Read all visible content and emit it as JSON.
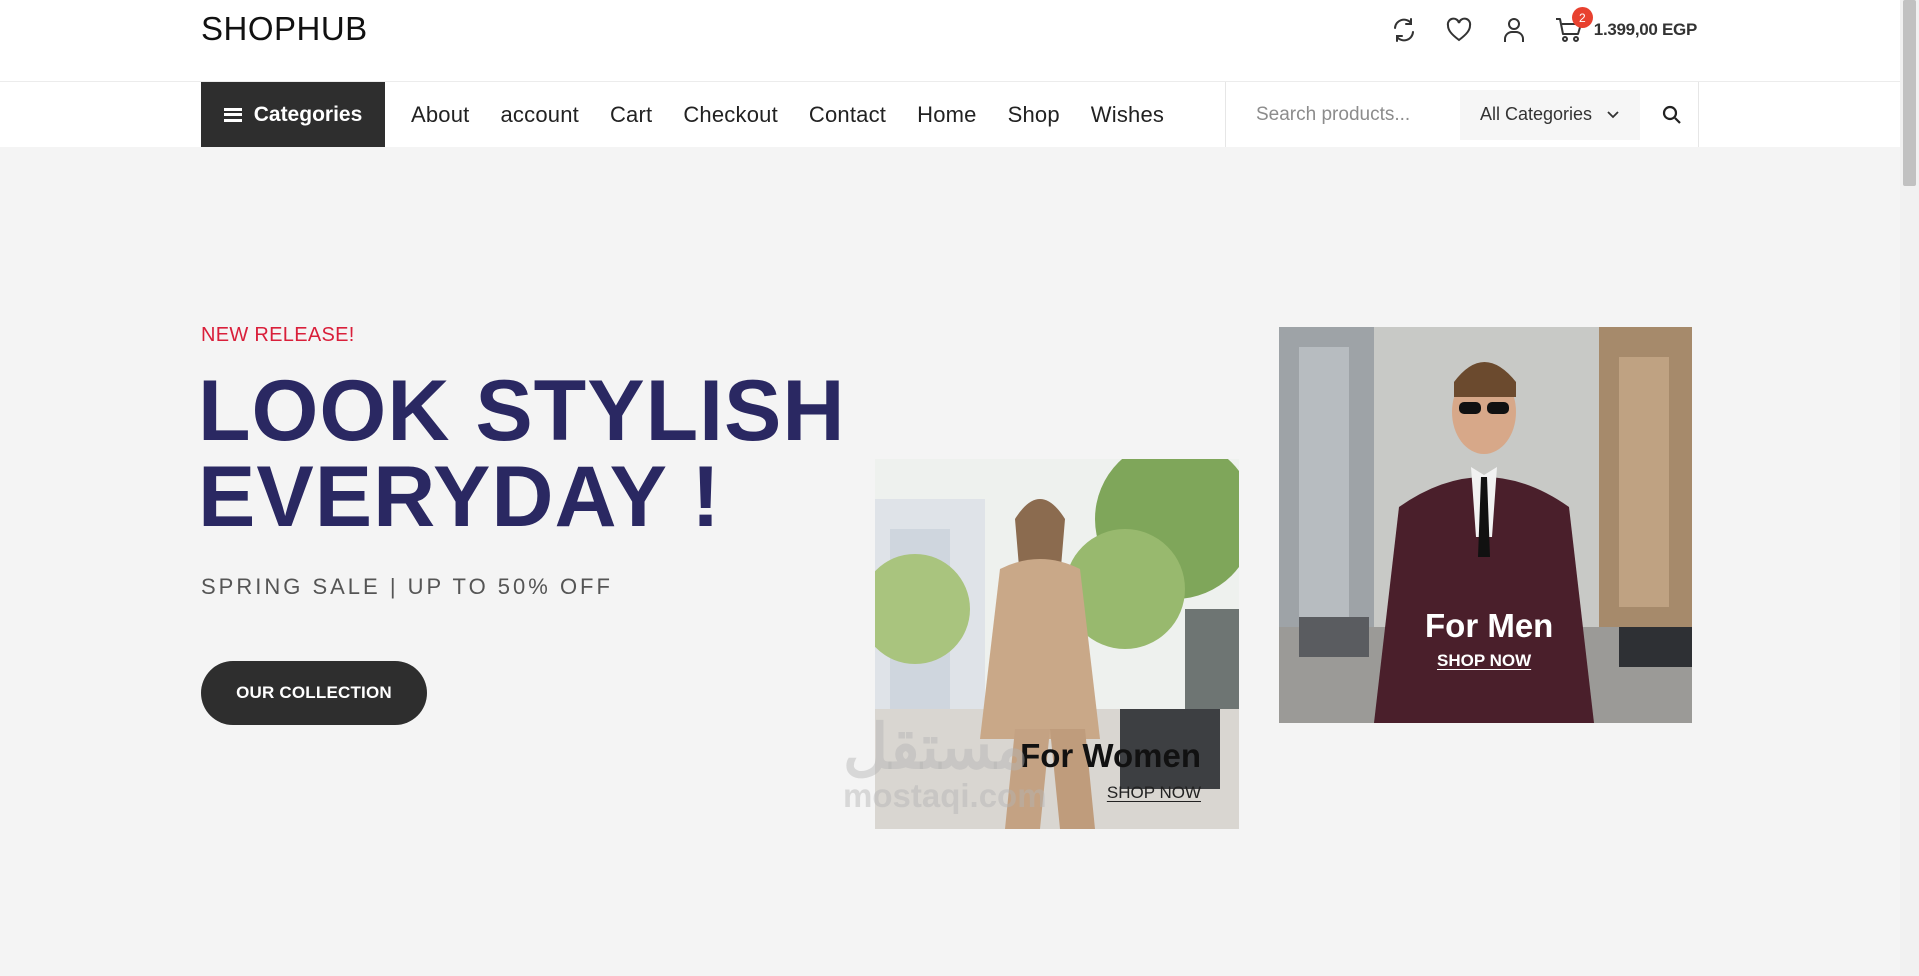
{
  "header": {
    "logo": "SHOPHUB",
    "icons": [
      "compare-icon",
      "wishlist-heart-icon",
      "user-account-icon",
      "shopping-cart-icon"
    ],
    "cart_count": "2",
    "cart_total": "1.399,00 EGP"
  },
  "nav": {
    "categories_label": "Categories",
    "menu": [
      "About",
      "account",
      "Cart",
      "Checkout",
      "Contact",
      "Home",
      "Shop",
      "Wishes"
    ],
    "search_placeholder": "Search products...",
    "category_select_value": "All Categories"
  },
  "hero": {
    "eyebrow": "NEW RELEASE!",
    "headline_line1": "LOOK STYLISH",
    "headline_line2": "EVERYDAY !",
    "subtitle": "SPRING SALE | UP TO 50% OFF",
    "cta_label": "OUR COLLECTION"
  },
  "promos": {
    "women": {
      "title": "For Women",
      "link": "SHOP NOW"
    },
    "men": {
      "title": "For Men",
      "link": "SHOP NOW"
    }
  },
  "watermark": {
    "arabic": "مستقل",
    "latin": "mostaqi.com"
  },
  "colors": {
    "accent_red": "#d91f3a",
    "headline_navy": "#2a2862",
    "dark_button": "#2e2e2e",
    "badge_red": "#e8412f",
    "hero_bg": "#f4f4f4"
  }
}
